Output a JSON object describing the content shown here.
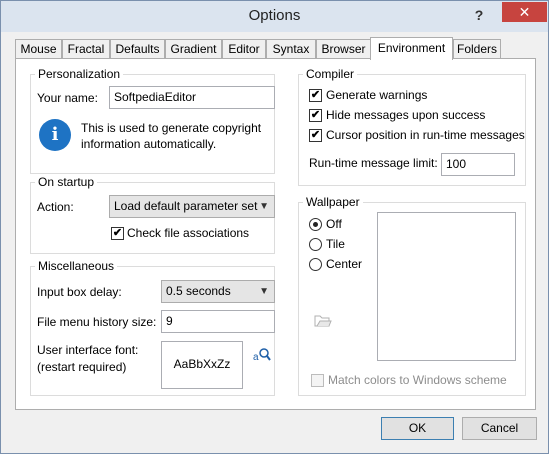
{
  "window": {
    "title": "Options",
    "help_glyph": "?",
    "close_glyph": "✕"
  },
  "tabs": [
    "Mouse",
    "Fractal",
    "Defaults",
    "Gradient",
    "Editor",
    "Syntax",
    "Browser",
    "Environment",
    "Folders"
  ],
  "active_tab": "Environment",
  "personalization": {
    "title": "Personalization",
    "name_label": "Your name:",
    "name_value": "SoftpediaEditor",
    "info_text_1": "This is used to generate copyright",
    "info_text_2": "information automatically."
  },
  "startup": {
    "title": "On startup",
    "action_label": "Action:",
    "action_value": "Load default parameter set",
    "check_assoc_label": "Check file associations",
    "check_assoc_checked": true
  },
  "misc": {
    "title": "Miscellaneous",
    "input_delay_label": "Input box delay:",
    "input_delay_value": "0.5 seconds",
    "history_label": "File menu history size:",
    "history_value": "9",
    "ui_font_label_1": "User interface font:",
    "ui_font_label_2": "(restart required)",
    "font_sample": "AaBbXxZz"
  },
  "compiler": {
    "title": "Compiler",
    "gen_warnings_label": "Generate warnings",
    "hide_messages_label": "Hide messages upon success",
    "cursor_label": "Cursor position in run-time messages",
    "limit_label": "Run-time message limit:",
    "limit_value": "100"
  },
  "wallpaper": {
    "title": "Wallpaper",
    "options": [
      "Off",
      "Tile",
      "Center"
    ],
    "selected": "Off",
    "match_colors_label": "Match colors to Windows scheme"
  },
  "buttons": {
    "ok": "OK",
    "cancel": "Cancel"
  },
  "colors": {
    "accent": "#3c7fb1",
    "close": "#c7443f",
    "titlebar": "#dbe4ef"
  }
}
